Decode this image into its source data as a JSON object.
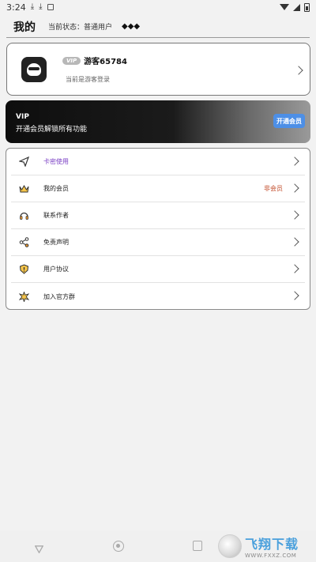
{
  "status_bar": {
    "time": "3:24"
  },
  "header": {
    "title": "我的",
    "status_text": "当前状态：普通用户",
    "diamonds": "◆◆◆"
  },
  "profile": {
    "vip_tag": "VIP",
    "username": "游客65784",
    "login_hint": "当前是游客登录"
  },
  "vip_banner": {
    "label": "VIP",
    "description": "开通会员解锁所有功能",
    "button": "开通会员"
  },
  "menu": {
    "items": [
      {
        "label": "卡密使用",
        "icon": "paper-plane-icon",
        "badge": ""
      },
      {
        "label": "我的会员",
        "icon": "crown-icon",
        "badge": "非会员"
      },
      {
        "label": "联系作者",
        "icon": "headset-icon",
        "badge": ""
      },
      {
        "label": "免责声明",
        "icon": "share-icon",
        "badge": ""
      },
      {
        "label": "用户协议",
        "icon": "warning-shield-icon",
        "badge": ""
      },
      {
        "label": "加入官方群",
        "icon": "group-spark-icon",
        "badge": ""
      }
    ]
  },
  "watermark": {
    "title": "飞翔下载",
    "url": "WWW.FXXZ.COM"
  },
  "colors": {
    "active_menu": "#7a3fc4",
    "badge": "#c24b2a",
    "vip_button": "#4d8fe6"
  }
}
